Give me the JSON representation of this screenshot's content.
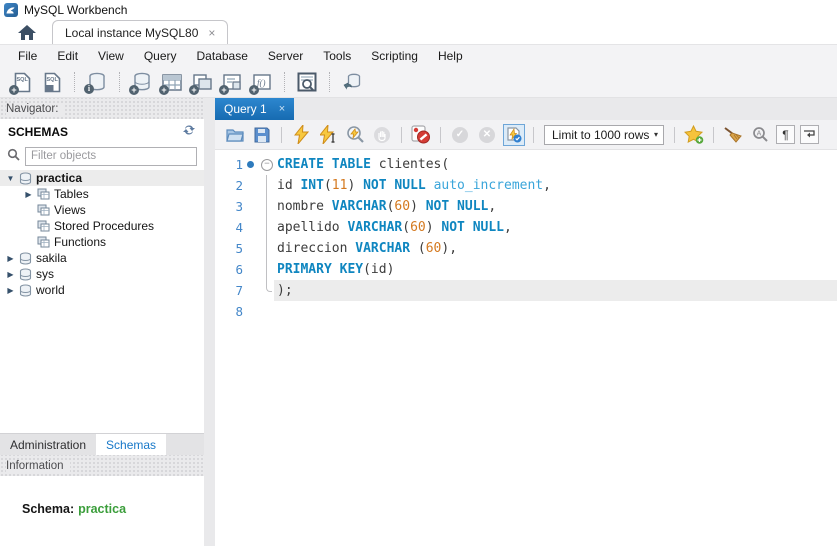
{
  "window": {
    "title": "MySQL Workbench",
    "logo_icon": "mysql-dolphin-icon"
  },
  "connection_tabs": {
    "home_icon": "home-icon",
    "active_tab": {
      "label": "Local instance MySQL80",
      "close": "×"
    }
  },
  "menu": {
    "items": [
      "File",
      "Edit",
      "View",
      "Query",
      "Database",
      "Server",
      "Tools",
      "Scripting",
      "Help"
    ]
  },
  "main_toolbar": {
    "icons": [
      "new-sql-tab-icon",
      "open-sql-script-icon",
      "inspector-icon",
      "create-schema-icon",
      "create-table-icon",
      "create-view-icon",
      "create-procedure-icon",
      "create-function-icon",
      "search-table-data-icon",
      "reconnect-dbms-icon"
    ]
  },
  "navigator": {
    "header": "Navigator:",
    "schemas_header": "SCHEMAS",
    "refresh_icon": "refresh-schemas-icon",
    "filter": {
      "placeholder": "Filter objects",
      "icon": "search-icon"
    },
    "tree": [
      {
        "label": "practica",
        "icon": "schema",
        "arrow": "down",
        "level": 0,
        "selected": true,
        "bold": true
      },
      {
        "label": "Tables",
        "icon": "table-group",
        "arrow": "right",
        "level": 1
      },
      {
        "label": "Views",
        "icon": "table-group",
        "arrow": "",
        "level": 1
      },
      {
        "label": "Stored Procedures",
        "icon": "table-group",
        "arrow": "",
        "level": 1
      },
      {
        "label": "Functions",
        "icon": "table-group",
        "arrow": "",
        "level": 1
      },
      {
        "label": "sakila",
        "icon": "schema",
        "arrow": "right",
        "level": 0
      },
      {
        "label": "sys",
        "icon": "schema",
        "arrow": "right",
        "level": 0
      },
      {
        "label": "world",
        "icon": "schema",
        "arrow": "right",
        "level": 0
      }
    ],
    "bottom_tabs": [
      {
        "label": "Administration",
        "active": false
      },
      {
        "label": "Schemas",
        "active": true
      }
    ],
    "information_header": "Information",
    "info": {
      "label": "Schema:",
      "value": "practica"
    }
  },
  "editor": {
    "tab": {
      "label": "Query 1",
      "close": "×"
    },
    "toolbar": {
      "icons": [
        "open-file-icon",
        "save-icon",
        "execute-icon",
        "execute-current-icon",
        "explain-icon",
        "stop-icon",
        "stop-on-error-toggle-icon",
        "commit-icon",
        "rollback-icon",
        "autocommit-toggle-icon",
        "save-snippet-icon",
        "beautify-icon",
        "find-icon",
        "invisible-chars-toggle-icon",
        "wrap-text-toggle-icon"
      ],
      "limit_dropdown": "Limit to 1000 rows",
      "dropdown_caret": "▾"
    },
    "colors": {
      "keyword": "#0f86c0",
      "minor_keyword": "#3aa5da",
      "number": "#d4791f",
      "plain": "#3c3c3c",
      "line_number": "#4487c9",
      "current_line_bg": "#ececec",
      "active_tab_bg": "#1d74b8",
      "schema_value_green": "#3b9e3b"
    },
    "lines": [
      {
        "no": "1",
        "marker": "dot",
        "fold": "start",
        "tokens": [
          {
            "t": "CREATE TABLE ",
            "c": "kw"
          },
          {
            "t": "clientes(",
            "c": "pl"
          }
        ]
      },
      {
        "no": "2",
        "marker": "",
        "fold": "mid",
        "tokens": [
          {
            "t": "id ",
            "c": "pl"
          },
          {
            "t": "INT",
            "c": "kw"
          },
          {
            "t": "(",
            "c": "pl"
          },
          {
            "t": "11",
            "c": "num"
          },
          {
            "t": ") ",
            "c": "pl"
          },
          {
            "t": "NOT NULL ",
            "c": "kw"
          },
          {
            "t": "auto_increment",
            "c": "mkw"
          },
          {
            "t": ",",
            "c": "pl"
          }
        ]
      },
      {
        "no": "3",
        "marker": "",
        "fold": "mid",
        "tokens": [
          {
            "t": "nombre ",
            "c": "pl"
          },
          {
            "t": "VARCHAR",
            "c": "kw"
          },
          {
            "t": "(",
            "c": "pl"
          },
          {
            "t": "60",
            "c": "num"
          },
          {
            "t": ") ",
            "c": "pl"
          },
          {
            "t": "NOT NULL",
            "c": "kw"
          },
          {
            "t": ",",
            "c": "pl"
          }
        ]
      },
      {
        "no": "4",
        "marker": "",
        "fold": "mid",
        "tokens": [
          {
            "t": "apellido ",
            "c": "pl"
          },
          {
            "t": "VARCHAR",
            "c": "kw"
          },
          {
            "t": "(",
            "c": "pl"
          },
          {
            "t": "60",
            "c": "num"
          },
          {
            "t": ") ",
            "c": "pl"
          },
          {
            "t": "NOT NULL",
            "c": "kw"
          },
          {
            "t": ",",
            "c": "pl"
          }
        ]
      },
      {
        "no": "5",
        "marker": "",
        "fold": "mid",
        "tokens": [
          {
            "t": "direccion ",
            "c": "pl"
          },
          {
            "t": "VARCHAR ",
            "c": "kw"
          },
          {
            "t": "(",
            "c": "pl"
          },
          {
            "t": "60",
            "c": "num"
          },
          {
            "t": "),",
            "c": "pl"
          }
        ]
      },
      {
        "no": "6",
        "marker": "",
        "fold": "mid",
        "tokens": [
          {
            "t": "PRIMARY KEY",
            "c": "kw"
          },
          {
            "t": "(id)",
            "c": "pl"
          }
        ]
      },
      {
        "no": "7",
        "marker": "",
        "fold": "end",
        "current": true,
        "tokens": [
          {
            "t": ");",
            "c": "pl"
          }
        ]
      },
      {
        "no": "8",
        "marker": "",
        "fold": "",
        "tokens": []
      }
    ]
  }
}
